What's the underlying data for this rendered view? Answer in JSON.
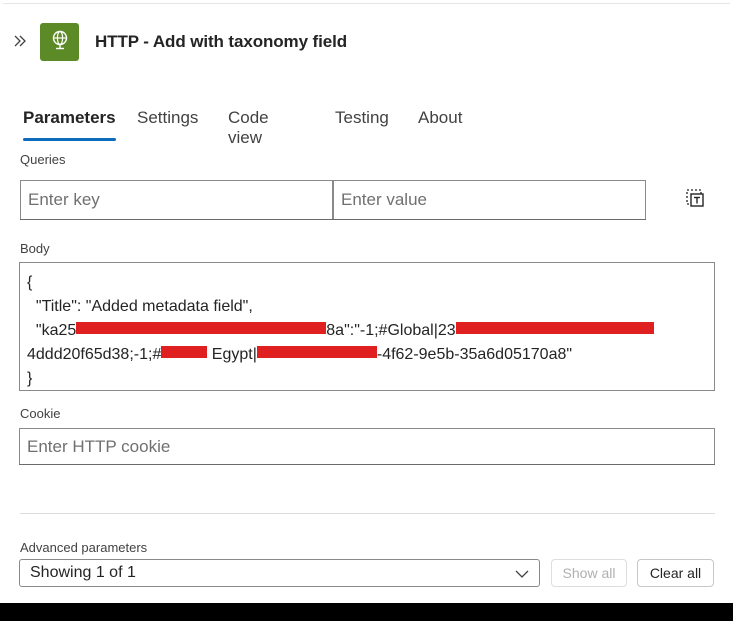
{
  "header": {
    "title": "HTTP - Add with taxonomy field",
    "icon": "http-globe-icon",
    "icon_color": "#5c8a27"
  },
  "tabs": [
    {
      "label": "Parameters",
      "active": true
    },
    {
      "label": "Settings",
      "active": false
    },
    {
      "label": "Code view",
      "active": false
    },
    {
      "label": "Testing",
      "active": false
    },
    {
      "label": "About",
      "active": false
    }
  ],
  "accent_color": "#0f6cbd",
  "queries": {
    "label": "Queries",
    "key_placeholder": "Enter key",
    "value_placeholder": "Enter value"
  },
  "body": {
    "label": "Body",
    "line1": "{",
    "line2": "  \"Title\": \"Added metadata field\",",
    "line3_a": "  \"ka25",
    "line3_b": "8a\":\"-1;#Global|23",
    "line4_a": "4ddd20f65d38;-1;#",
    "line4_b": " Egypt|",
    "line4_c": "-4f62-9e5b-35a6d05170a8\"",
    "line5": "}"
  },
  "cookie": {
    "label": "Cookie",
    "placeholder": "Enter HTTP cookie"
  },
  "advanced": {
    "label": "Advanced parameters",
    "selected": "Showing 1 of 1",
    "show_all": "Show all",
    "clear_all": "Clear all"
  }
}
